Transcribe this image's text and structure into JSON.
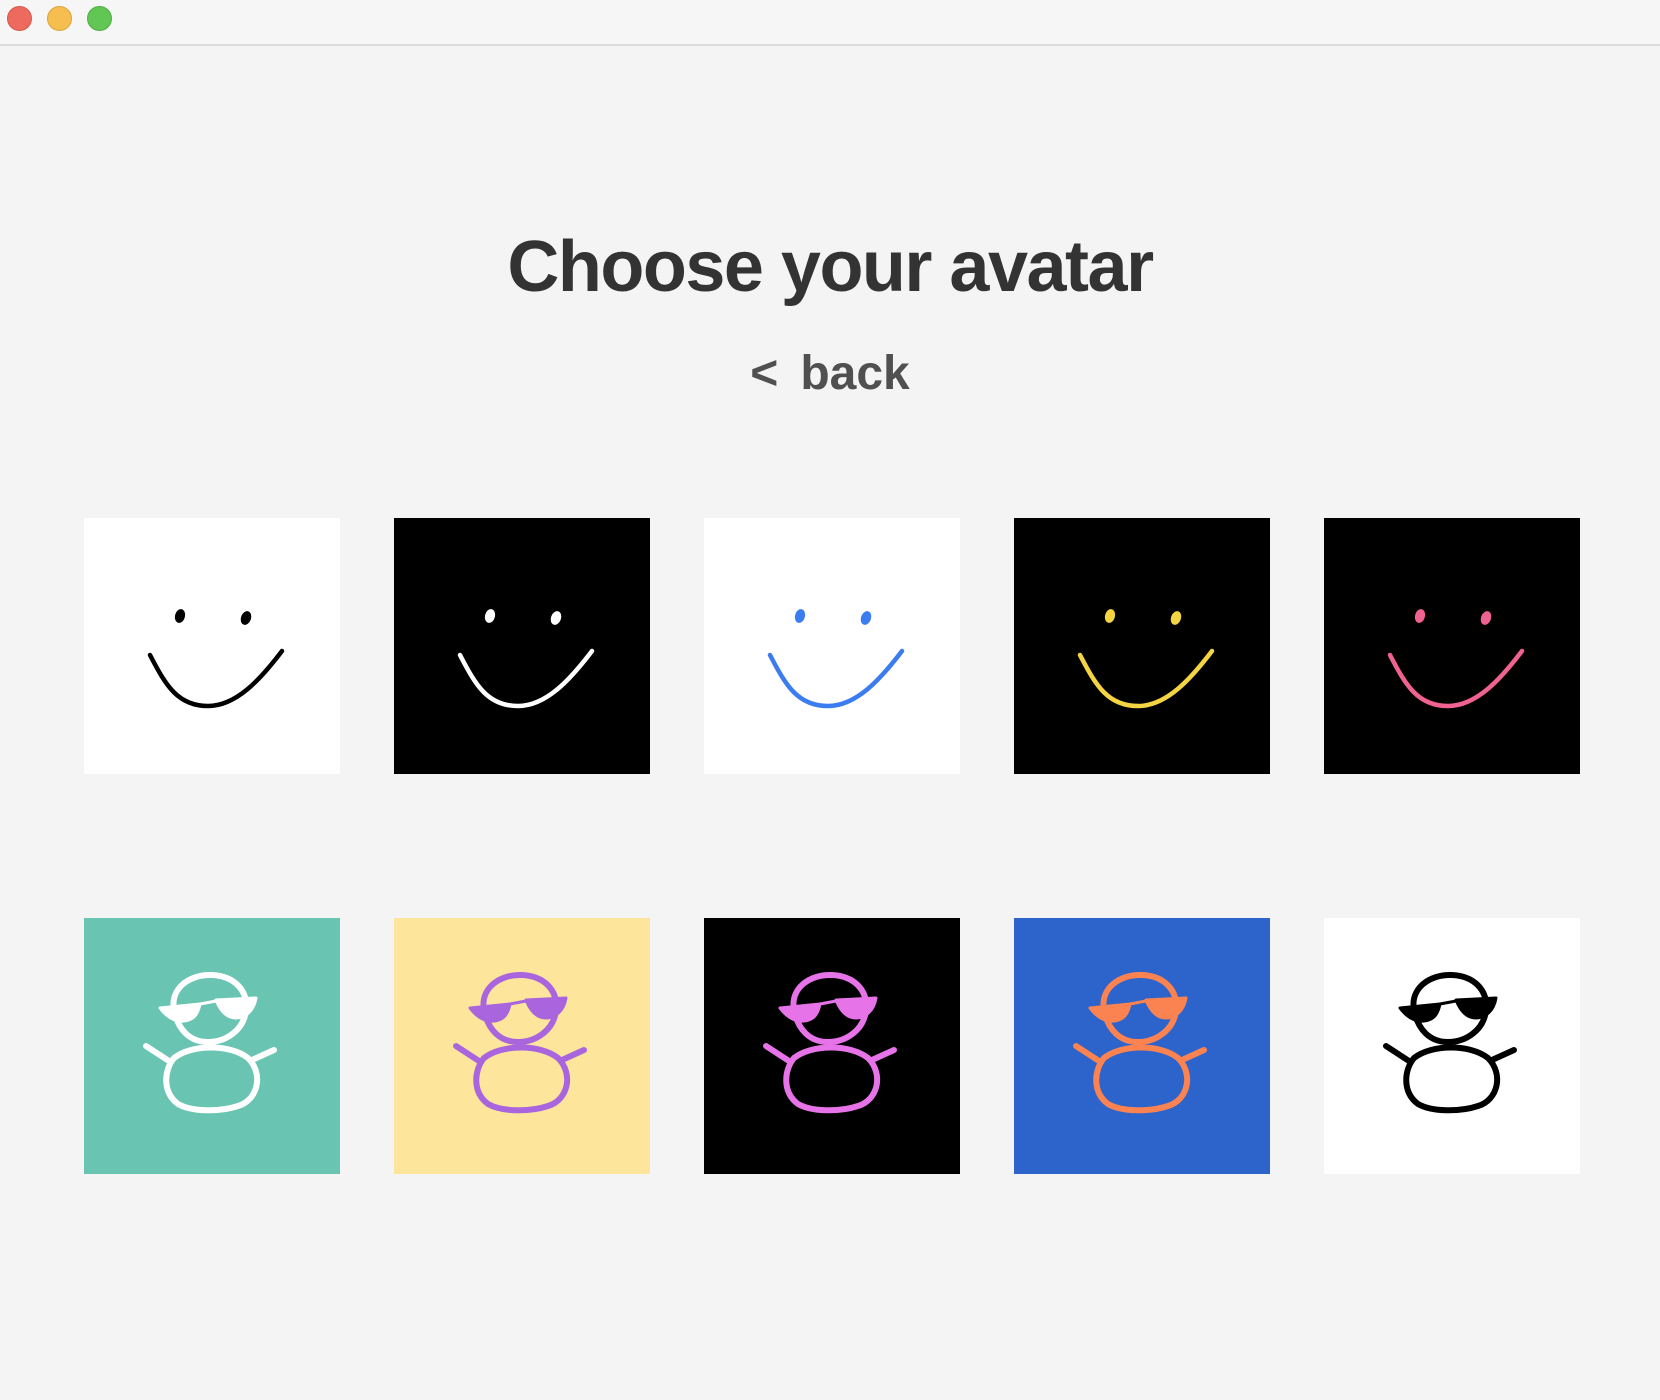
{
  "window": {
    "controls": [
      "close",
      "minimize",
      "zoom"
    ]
  },
  "page": {
    "title": "Choose your avatar",
    "back": {
      "chevron": "<",
      "label": "back"
    }
  },
  "avatars": {
    "smiley": [
      {
        "bg": "#ffffff",
        "fg": "#000000"
      },
      {
        "bg": "#000000",
        "fg": "#ffffff"
      },
      {
        "bg": "#ffffff",
        "fg": "#3b7cf0"
      },
      {
        "bg": "#000000",
        "fg": "#f5d442"
      },
      {
        "bg": "#000000",
        "fg": "#f06292"
      }
    ],
    "character": [
      {
        "bg": "#69c5b2",
        "fg": "#ffffff",
        "glasses": "#ffffff"
      },
      {
        "bg": "#fde59b",
        "fg": "#a965dd",
        "glasses": "#a965dd"
      },
      {
        "bg": "#000000",
        "fg": "#e673e8",
        "glasses": "#e673e8"
      },
      {
        "bg": "#2c64cb",
        "fg": "#fb8251",
        "glasses": "#fb8251"
      },
      {
        "bg": "#ffffff",
        "fg": "#000000",
        "glasses": "#000000"
      }
    ]
  }
}
